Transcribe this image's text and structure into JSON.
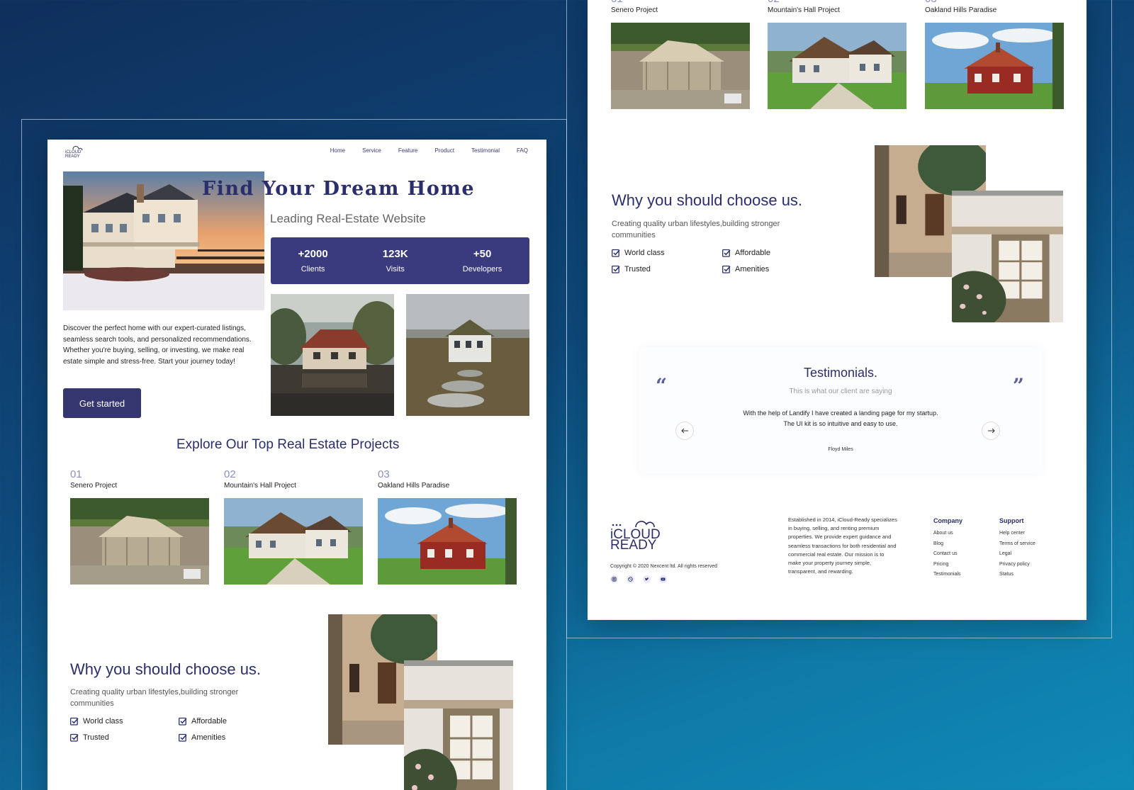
{
  "brand": {
    "name": "iCloud Ready",
    "logo_line1": "iCLOUD",
    "logo_line2": "READY"
  },
  "nav": {
    "items": [
      "Home",
      "Service",
      "Feature",
      "Product",
      "Testimonial",
      "FAQ"
    ]
  },
  "hero": {
    "title": "Find Your Dream Home",
    "subtitle": "Leading Real-Estate Website",
    "description": "Discover the perfect home with our expert-curated listings, seamless search tools, and personalized recommendations. Whether you're buying, selling, or investing, we make real estate simple and stress-free. Start your journey today!",
    "cta_label": "Get started"
  },
  "stats": [
    {
      "value": "+2000",
      "label": "Clients"
    },
    {
      "value": "123K",
      "label": "Visits"
    },
    {
      "value": "+50",
      "label": "Developers"
    }
  ],
  "projects": {
    "title": "Explore Our Top Real Estate Projects",
    "items": [
      {
        "num": "01",
        "name": "Senero Project"
      },
      {
        "num": "02",
        "name": "Mountain's Hall Project"
      },
      {
        "num": "03",
        "name": "Oakland Hills Paradise"
      }
    ]
  },
  "why": {
    "title": "Why you should choose us.",
    "description": "Creating quality urban lifestyles,building stronger communities",
    "features": [
      "World class",
      "Affordable",
      "Trusted",
      "Amenities"
    ]
  },
  "testimonials": {
    "title": "Testimonials.",
    "subtitle": "This is what our client are saying",
    "quote": "With the help of Landify I have created a landing page for my startup. The UI kit is so intuitive and easy to use.",
    "author": "Floyd Miles",
    "open_mark": "“",
    "close_mark": "”",
    "prev_icon": "arrow-left-icon",
    "next_icon": "arrow-right-icon"
  },
  "footer": {
    "copyright": "Copyright © 2020 Nexcent ltd. All rights reserved",
    "about": "Established in 2014, iCloud-Ready specializes in buying, selling, and renting premium properties. We provide expert guidance and seamless transactions for both residential and commercial real estate. Our mission is to make your property journey simple, transparent, and rewarding.",
    "company": {
      "title": "Company",
      "links": [
        "About us",
        "Blog",
        "Contact us",
        "Pricing",
        "Testimonials"
      ]
    },
    "support": {
      "title": "Support",
      "links": [
        "Help center",
        "Terms of service",
        "Legal",
        "Privacy policy",
        "Status"
      ]
    },
    "socials": [
      "instagram-icon",
      "dribbble-icon",
      "twitter-icon",
      "youtube-icon"
    ]
  },
  "colors": {
    "primary": "#35356f",
    "accent": "#2b2e6b",
    "muted_number": "#8b8fbf"
  }
}
